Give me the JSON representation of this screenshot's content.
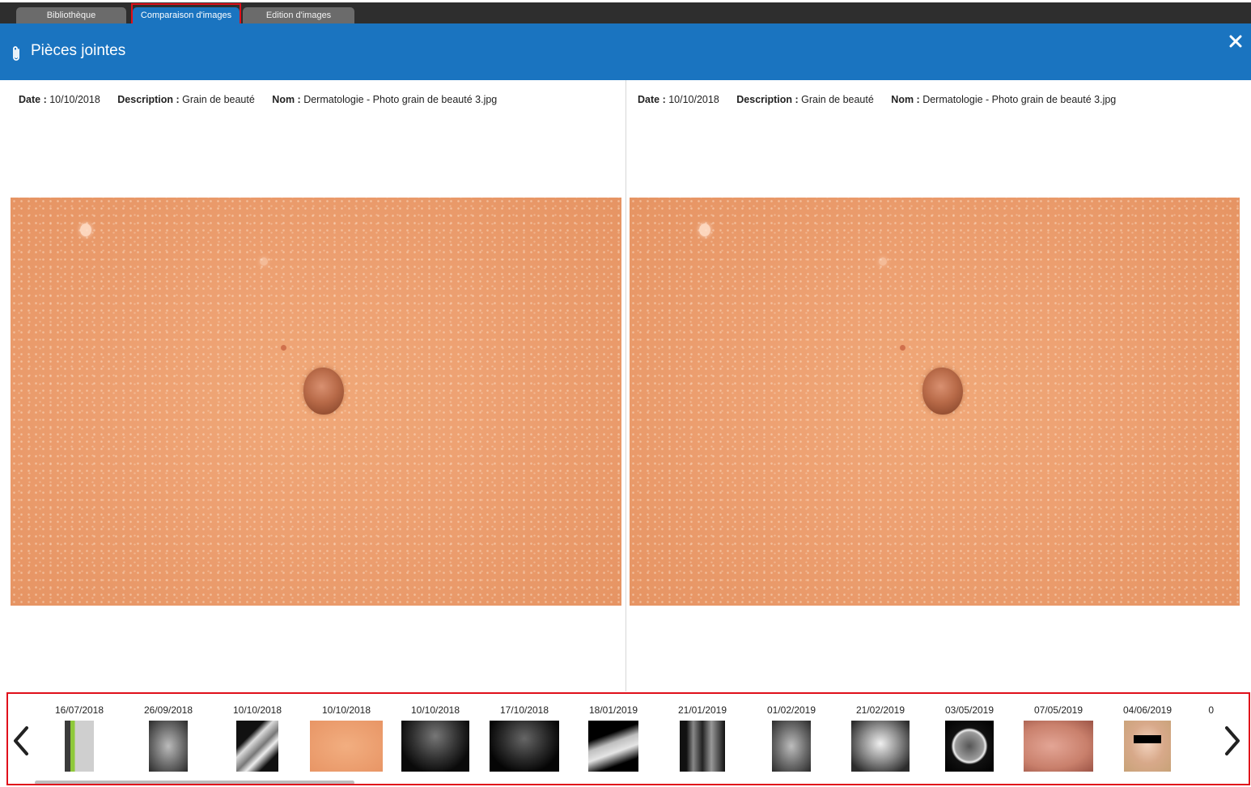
{
  "tabs": [
    {
      "label": "Bibliothèque",
      "active": false
    },
    {
      "label": "Comparaison d'images",
      "active": true
    },
    {
      "label": "Edition d'images",
      "active": false
    }
  ],
  "header": {
    "title": "Pièces jointes",
    "icon": "paperclip-icon",
    "close_icon": "close-icon",
    "color": "#1a74c0"
  },
  "left_panel": {
    "date_label": "Date :",
    "date": "10/10/2018",
    "description_label": "Description :",
    "description": "Grain de beauté",
    "name_label": "Nom :",
    "name": "Dermatologie - Photo grain de beauté 3.jpg"
  },
  "right_panel": {
    "date_label": "Date :",
    "date": "10/10/2018",
    "description_label": "Description :",
    "description": "Grain de beauté",
    "name_label": "Nom :",
    "name": "Dermatologie - Photo grain de beauté 3.jpg"
  },
  "thumbnails": [
    {
      "date": "16/07/2018",
      "kind": "document-photo"
    },
    {
      "date": "26/09/2018",
      "kind": "abdominal-xray"
    },
    {
      "date": "10/10/2018",
      "kind": "knee-xray"
    },
    {
      "date": "10/10/2018",
      "kind": "skin-mole-photo"
    },
    {
      "date": "10/10/2018",
      "kind": "ultrasound"
    },
    {
      "date": "17/10/2018",
      "kind": "ultrasound"
    },
    {
      "date": "18/01/2019",
      "kind": "foot-xray"
    },
    {
      "date": "21/01/2019",
      "kind": "knee-mri"
    },
    {
      "date": "01/02/2019",
      "kind": "abdominal-xray"
    },
    {
      "date": "21/02/2019",
      "kind": "chest-xray"
    },
    {
      "date": "03/05/2019",
      "kind": "brain-ct"
    },
    {
      "date": "07/05/2019",
      "kind": "face-skin-photo"
    },
    {
      "date": "04/06/2019",
      "kind": "face-photo"
    },
    {
      "date": "0",
      "kind": "partial"
    }
  ],
  "strip": {
    "prev_icon": "chevron-left-icon",
    "next_icon": "chevron-right-icon"
  },
  "highlight_color": "#e0101b"
}
